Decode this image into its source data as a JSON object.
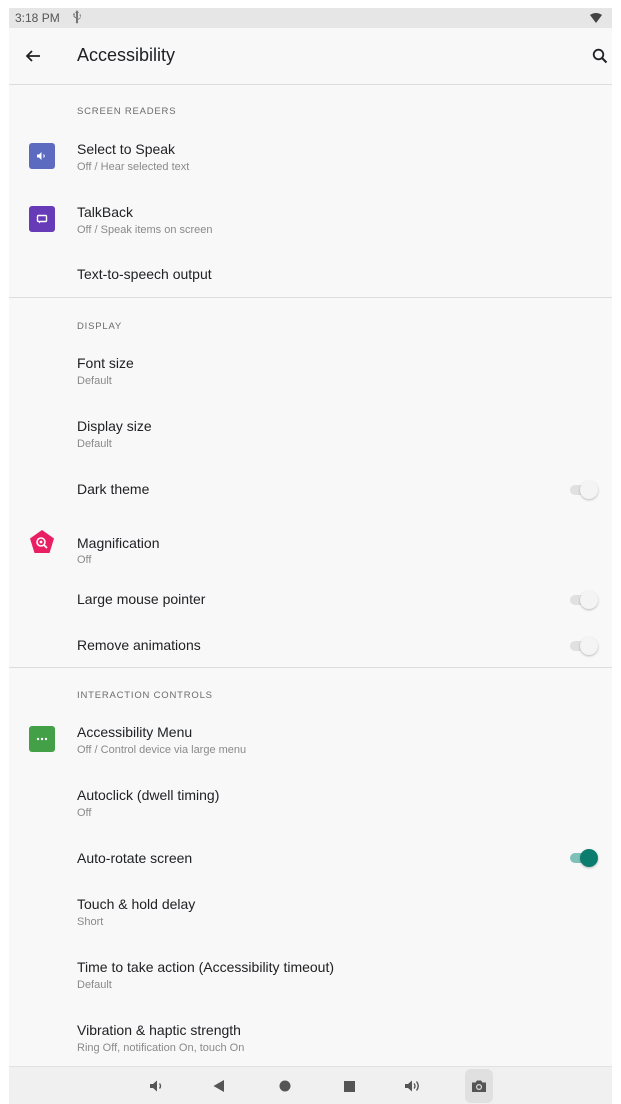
{
  "status_bar": {
    "time": "3:18 PM",
    "usb_icon": "usb-icon",
    "wifi_icon": "wifi-icon"
  },
  "app_bar": {
    "title": "Accessibility",
    "back_icon": "arrow-left-icon",
    "search_icon": "search-icon"
  },
  "sections": {
    "screen_readers": {
      "header": "SCREEN READERS",
      "select_to_speak": {
        "title": "Select to Speak",
        "subtitle": "Off / Hear selected text",
        "icon": "select-to-speak-icon",
        "icon_color": "#5c6bc0"
      },
      "talkback": {
        "title": "TalkBack",
        "subtitle": "Off / Speak items on screen",
        "icon": "talkback-icon",
        "icon_color": "#673ab7"
      },
      "tts": {
        "title": "Text-to-speech output"
      }
    },
    "display": {
      "header": "DISPLAY",
      "font_size": {
        "title": "Font size",
        "subtitle": "Default"
      },
      "display_size": {
        "title": "Display size",
        "subtitle": "Default"
      },
      "dark_theme": {
        "title": "Dark theme",
        "checked": false
      },
      "magnification": {
        "title": "Magnification",
        "subtitle": "Off",
        "icon": "magnification-icon",
        "icon_color": "#e91e63"
      },
      "large_pointer": {
        "title": "Large mouse pointer",
        "checked": false
      },
      "remove_animations": {
        "title": "Remove animations",
        "checked": false
      }
    },
    "interaction": {
      "header": "INTERACTION CONTROLS",
      "accessibility_menu": {
        "title": "Accessibility Menu",
        "subtitle": "Off / Control device via large menu",
        "icon": "accessibility-menu-icon",
        "icon_color": "#43a047"
      },
      "autoclick": {
        "title": "Autoclick (dwell timing)",
        "subtitle": "Off"
      },
      "auto_rotate": {
        "title": "Auto-rotate screen",
        "checked": true
      },
      "touch_hold": {
        "title": "Touch & hold delay",
        "subtitle": "Short"
      },
      "timeout": {
        "title": "Time to take action (Accessibility timeout)",
        "subtitle": "Default"
      },
      "vibration": {
        "title": "Vibration & haptic strength",
        "subtitle": "Ring Off, notification On, touch On"
      }
    }
  },
  "nav_bar": {
    "buttons": [
      "volume-down-icon",
      "back-triangle-icon",
      "home-circle-icon",
      "recents-square-icon",
      "volume-up-icon",
      "camera-icon"
    ]
  },
  "colors": {
    "accent": "#0b7d6f",
    "background": "#f8f8f8"
  }
}
